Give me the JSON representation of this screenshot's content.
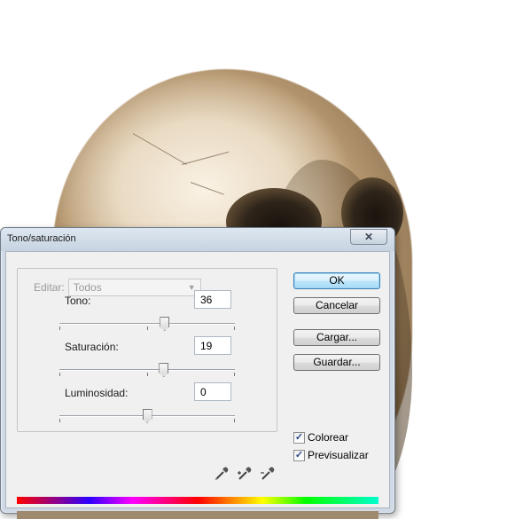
{
  "dialog": {
    "title": "Tono/saturación",
    "edit_label": "Editar:",
    "edit_value": "Todos",
    "params": [
      {
        "label": "Tono:",
        "value": "36",
        "slider_min": -180,
        "slider_max": 180,
        "slider_value": 36
      },
      {
        "label": "Saturación:",
        "value": "19",
        "slider_min": -100,
        "slider_max": 100,
        "slider_value": 19
      },
      {
        "label": "Luminosidad:",
        "value": "0",
        "slider_min": -100,
        "slider_max": 100,
        "slider_value": 0
      }
    ],
    "buttons": {
      "ok": "OK",
      "cancel": "Cancelar",
      "load": "Cargar...",
      "save": "Guardar..."
    },
    "checkboxes": {
      "colorize": {
        "label": "Colorear",
        "checked": true
      },
      "preview": {
        "label": "Previsualizar",
        "checked": true
      }
    },
    "icons": {
      "close": "close-icon",
      "eyedropper": "eyedropper-icon",
      "eyedropper_add": "eyedropper-plus-icon",
      "eyedropper_subtract": "eyedropper-minus-icon",
      "dropdown": "chevron-down-icon"
    },
    "colors": {
      "result_bar": "#a08a6e"
    }
  }
}
